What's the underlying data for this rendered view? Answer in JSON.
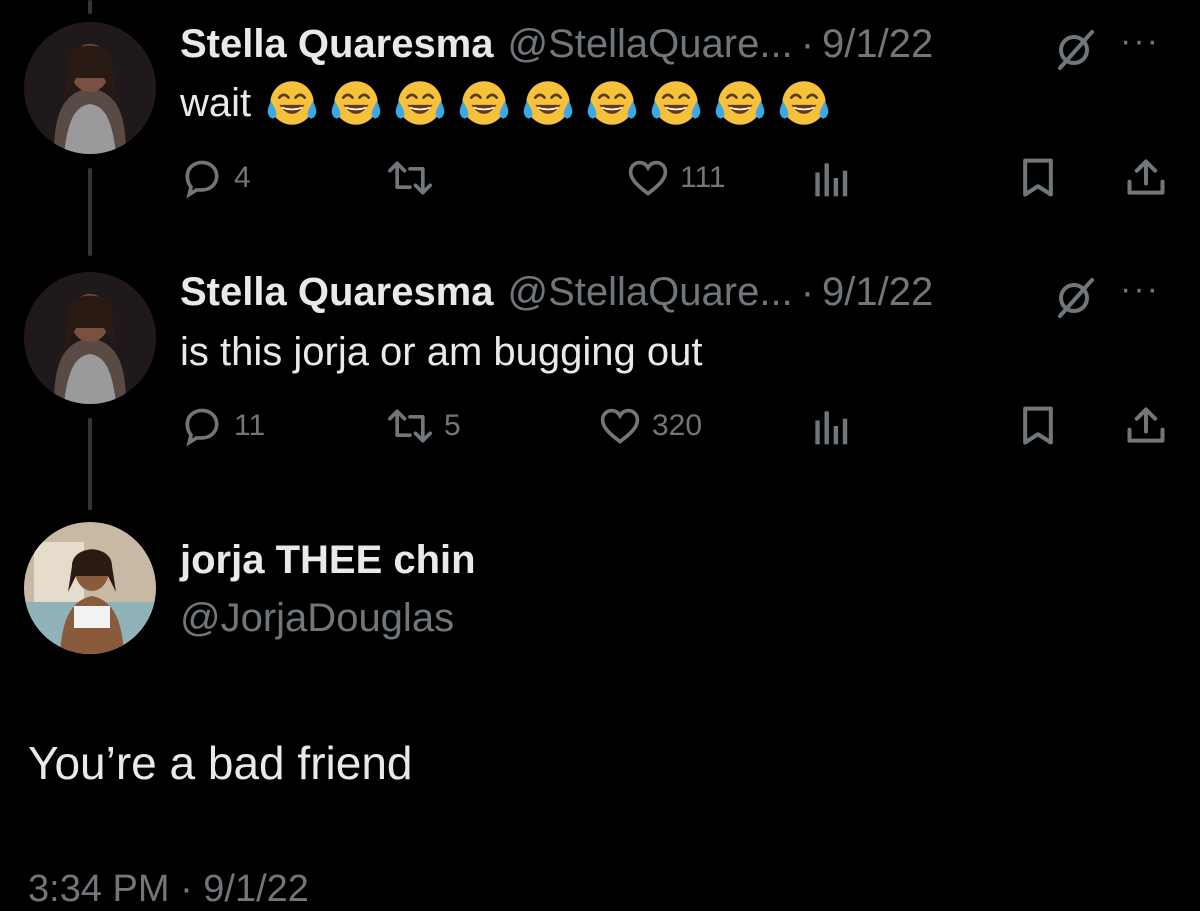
{
  "tweets": [
    {
      "name": "Stella Quaresma",
      "handle": "@StellaQuare...",
      "sep": "·",
      "date": "9/1/22",
      "text": "wait",
      "emoji_count": 9,
      "emoji": "face-with-tears-of-joy",
      "replies": "4",
      "retweets": "",
      "likes": "111"
    },
    {
      "name": "Stella Quaresma",
      "handle": "@StellaQuare...",
      "sep": "·",
      "date": "9/1/22",
      "text": "is this jorja or am bugging out",
      "replies": "11",
      "retweets": "5",
      "likes": "320"
    }
  ],
  "main_tweet": {
    "name": "jorja THEE chin",
    "handle": "@JorjaDouglas",
    "text": "You’re a bad friend",
    "time": "3:34 PM · 9/1/22"
  },
  "icons": {
    "reply": "reply-icon",
    "retweet": "retweet-icon",
    "like": "heart-icon",
    "views": "views-icon",
    "bookmark": "bookmark-icon",
    "share": "share-icon",
    "grok": "grok-icon",
    "more": "more-icon"
  },
  "colors": {
    "background": "#000000",
    "text": "#e7e9ea",
    "secondary": "#71767b"
  }
}
